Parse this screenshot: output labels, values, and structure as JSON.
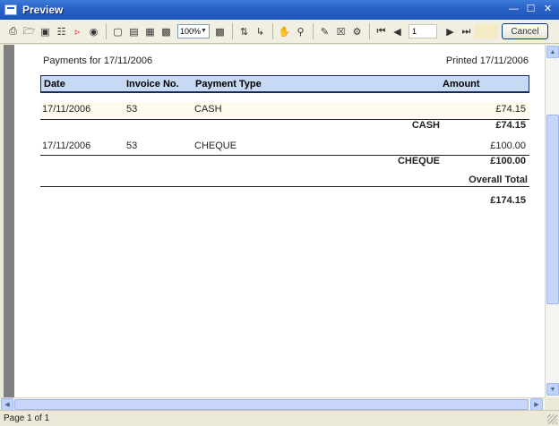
{
  "window": {
    "title": "Preview"
  },
  "toolbar": {
    "zoom": "100%",
    "page_number": "1",
    "cancel_label": "Cancel"
  },
  "report": {
    "header_left": "Payments for 17/11/2006",
    "header_right": "Printed 17/11/2006",
    "columns": [
      "Date",
      "Invoice No.",
      "Payment Type",
      "Amount"
    ],
    "rows": [
      {
        "date": "17/11/2006",
        "invoice": "53",
        "type": "CASH",
        "amount": "£74.15"
      },
      {
        "date": "17/11/2006",
        "invoice": "53",
        "type": "CHEQUE",
        "amount": "£100.00"
      }
    ],
    "subtotals": [
      {
        "label": "CASH",
        "amount": "£74.15"
      },
      {
        "label": "CHEQUE",
        "amount": "£100.00"
      }
    ],
    "overall_label": "Overall Total",
    "overall_amount": "£174.15"
  },
  "status": {
    "page_info": "Page 1 of 1"
  },
  "colors": {
    "titlebar": "#2a63c9",
    "column_header_bg": "#c8d9f3",
    "column_header_border": "#1b2b5a"
  }
}
